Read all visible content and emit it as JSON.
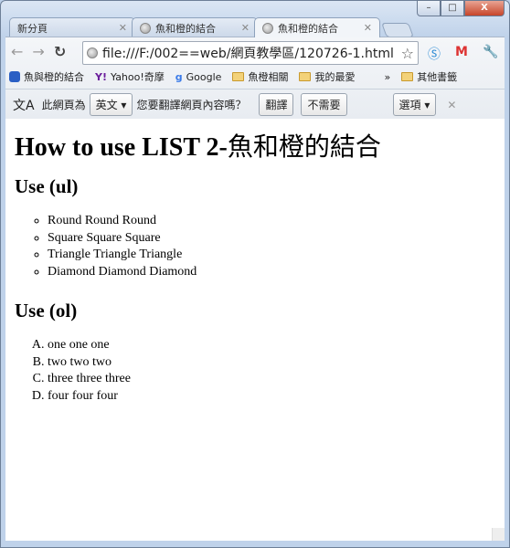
{
  "window": {
    "min": "▭",
    "max": "□",
    "close": "X"
  },
  "tabs": [
    {
      "label": "新分頁",
      "icon": "none"
    },
    {
      "label": "魚和橙的結合",
      "icon": "globe-icon"
    },
    {
      "label": "魚和橙的結合",
      "icon": "globe-icon",
      "active": true
    }
  ],
  "toolbar": {
    "url": "file:///F:/002==web/網頁教學區/120726-1.html"
  },
  "bookmarks": [
    {
      "label": "魚與橙的結合"
    },
    {
      "label": "Yahoo!奇摩"
    },
    {
      "label": "Google"
    },
    {
      "label": "魚橙相關"
    },
    {
      "label": "我的最愛"
    }
  ],
  "bookmarks_more": "»",
  "bookmarks_other": "其他書籤",
  "translate": {
    "prefix": "此網頁為",
    "language": "英文",
    "question": "您要翻譯網頁內容嗎？",
    "translate": "翻譯",
    "no": "不需要",
    "options": "選項"
  },
  "page": {
    "title_en": "How to use LIST 2-",
    "title_cjk": "魚和橙的結合",
    "ul_heading": "Use (ul)",
    "ul_items": [
      "Round Round Round",
      "Square Square Square",
      "Triangle Triangle Triangle",
      "Diamond Diamond Diamond"
    ],
    "ol_heading": "Use (ol)",
    "ol_items": [
      "one one one",
      "two two two",
      "three three three",
      "four four four"
    ]
  }
}
